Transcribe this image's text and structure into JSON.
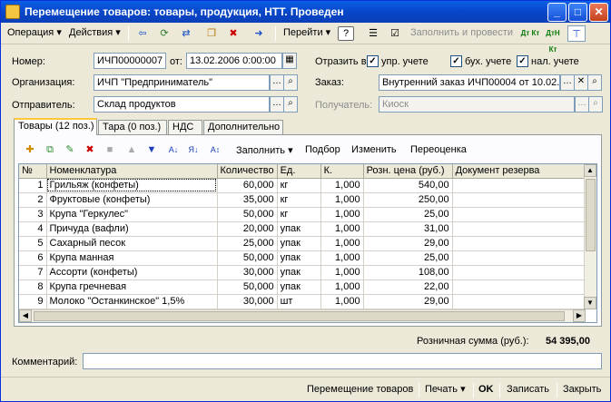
{
  "window": {
    "title": "Перемещение товаров: товары, продукция, НТТ. Проведен",
    "min_glyph": "_",
    "max_glyph": "□",
    "close_glyph": "✕"
  },
  "menubar": {
    "operation": "Операция",
    "actions": "Действия",
    "goto": "Перейти",
    "help_glyph": "?",
    "fill_and_post": "Заполнить и провести",
    "dt_kt": "Дт Кт",
    "dt_kt_n": "ДтН Кт"
  },
  "form": {
    "number_label": "Номер:",
    "number_value": "ИЧП00000007",
    "from_label": "от:",
    "date_value": "13.02.2006  0:00:00",
    "org_label": "Организация:",
    "org_value": "ИЧП \"Предприниматель\"",
    "sender_label": "Отправитель:",
    "sender_value": "Склад продуктов",
    "reflect_label": "Отразить в:",
    "reflect_mgmt": "упр. учете",
    "reflect_acc": "бух. учете",
    "reflect_tax": "нал. учете",
    "order_label": "Заказ:",
    "order_value": "Внутренний заказ ИЧП00004 от 10.02...",
    "receiver_label": "Получатель:",
    "receiver_value": "Киоск"
  },
  "tabs": [
    "Товары (12 поз.)",
    "Тара (0 поз.)",
    "НДС",
    "Дополнительно"
  ],
  "grid_toolbar": {
    "fill": "Заполнить",
    "selection": "Подбор",
    "change": "Изменить",
    "reprice": "Переоценка"
  },
  "table": {
    "columns": [
      "№",
      "Номенклатура",
      "Количество",
      "Ед.",
      "К.",
      "Розн. цена (руб.)",
      "Документ резерва"
    ],
    "rows": [
      [
        "1",
        "Грильяж (конфеты)",
        "60,000",
        "кг",
        "1,000",
        "540,00",
        ""
      ],
      [
        "2",
        "Фруктовые (конфеты)",
        "35,000",
        "кг",
        "1,000",
        "250,00",
        ""
      ],
      [
        "3",
        "Крупа \"Геркулес\"",
        "50,000",
        "кг",
        "1,000",
        "25,00",
        ""
      ],
      [
        "4",
        "Причуда (вафли)",
        "20,000",
        "упак",
        "1,000",
        "31,00",
        ""
      ],
      [
        "5",
        "Сахарный песок",
        "25,000",
        "упак",
        "1,000",
        "29,00",
        ""
      ],
      [
        "6",
        "Крупа манная",
        "50,000",
        "упак",
        "1,000",
        "25,00",
        ""
      ],
      [
        "7",
        "Ассорти (конфеты)",
        "30,000",
        "упак",
        "1,000",
        "108,00",
        ""
      ],
      [
        "8",
        "Крупа гречневая",
        "50,000",
        "упак",
        "1,000",
        "22,00",
        ""
      ],
      [
        "9",
        "Молоко \"Останкинское\" 1,5%",
        "30,000",
        "шт",
        "1,000",
        "29,00",
        ""
      ]
    ]
  },
  "totals": {
    "retail_sum_label": "Розничная сумма (руб.):",
    "retail_sum_value": "54 395,00"
  },
  "comment": {
    "label": "Комментарий:",
    "value": ""
  },
  "bottom": {
    "transfer": "Перемещение товаров",
    "print": "Печать",
    "ok": "OK",
    "save": "Записать",
    "close": "Закрыть"
  }
}
